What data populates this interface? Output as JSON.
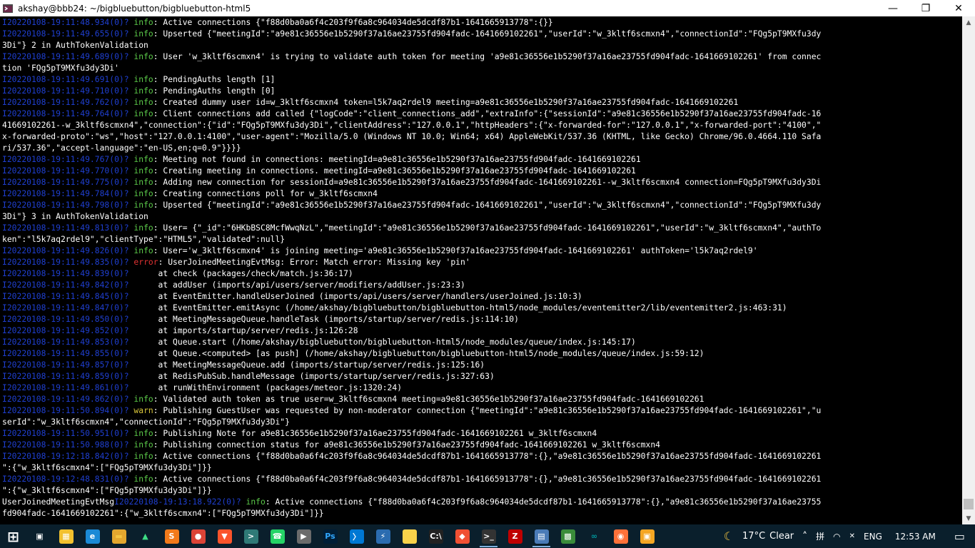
{
  "window": {
    "title": "akshay@bbb24: ~/bigbluebutton/bigbluebutton-html5",
    "minimize_label": "—",
    "maximize_label": "❐",
    "close_label": "✕"
  },
  "terminal": {
    "lines": [
      {
        "ts": "I20220108-19:11:48.934(0)?",
        "lvl": "info",
        "msg": ": Active connections {\"f88d0ba0a6f4c203f9f6a8c964034de5dcdf87b1-1641665913778\":{}}"
      },
      {
        "ts": "I20220108-19:11:49.655(0)?",
        "lvl": "info",
        "msg": ": Upserted {\"meetingId\":\"a9e81c36556e1b5290f37a16ae23755fd904fadc-1641669102261\",\"userId\":\"w_3kltf6scmxn4\",\"connectionId\":\"FQg5pT9MXfu3dy"
      },
      {
        "ts": "",
        "lvl": "",
        "msg": "3Di\"} 2 in AuthTokenValidation"
      },
      {
        "ts": "I20220108-19:11:49.689(0)?",
        "lvl": "info",
        "msg": ": User 'w_3kltf6scmxn4' is trying to validate auth token for meeting 'a9e81c36556e1b5290f37a16ae23755fd904fadc-1641669102261' from connec"
      },
      {
        "ts": "",
        "lvl": "",
        "msg": "tion 'FQg5pT9MXfu3dy3Di'"
      },
      {
        "ts": "I20220108-19:11:49.691(0)?",
        "lvl": "info",
        "msg": ": PendingAuths length [1]"
      },
      {
        "ts": "I20220108-19:11:49.710(0)?",
        "lvl": "info",
        "msg": ": PendingAuths length [0]"
      },
      {
        "ts": "I20220108-19:11:49.762(0)?",
        "lvl": "info",
        "msg": ": Created dummy user id=w_3kltf6scmxn4 token=l5k7aq2rdel9 meeting=a9e81c36556e1b5290f37a16ae23755fd904fadc-1641669102261"
      },
      {
        "ts": "I20220108-19:11:49.764(0)?",
        "lvl": "info",
        "msg": ": Client connections add called {\"logCode\":\"client_connections_add\",\"extraInfo\":{\"sessionId\":\"a9e81c36556e1b5290f37a16ae23755fd904fadc-16"
      },
      {
        "ts": "",
        "lvl": "",
        "msg": "41669102261--w_3kltf6scmxn4\",\"connection\":{\"id\":\"FQg5pT9MXfu3dy3Di\",\"clientAddress\":\"127.0.0.1\",\"httpHeaders\":{\"x-forwarded-for\":\"127.0.0.1\",\"x-forwarded-port\":\"4100\",\""
      },
      {
        "ts": "",
        "lvl": "",
        "msg": "x-forwarded-proto\":\"ws\",\"host\":\"127.0.0.1:4100\",\"user-agent\":\"Mozilla/5.0 (Windows NT 10.0; Win64; x64) AppleWebKit/537.36 (KHTML, like Gecko) Chrome/96.0.4664.110 Safa"
      },
      {
        "ts": "",
        "lvl": "",
        "msg": "ri/537.36\",\"accept-language\":\"en-US,en;q=0.9\"}}}}"
      },
      {
        "ts": "I20220108-19:11:49.767(0)?",
        "lvl": "info",
        "msg": ": Meeting not found in connections: meetingId=a9e81c36556e1b5290f37a16ae23755fd904fadc-1641669102261"
      },
      {
        "ts": "I20220108-19:11:49.770(0)?",
        "lvl": "info",
        "msg": ": Creating meeting in connections. meetingId=a9e81c36556e1b5290f37a16ae23755fd904fadc-1641669102261"
      },
      {
        "ts": "I20220108-19:11:49.775(0)?",
        "lvl": "info",
        "msg": ": Adding new connection for sessionId=a9e81c36556e1b5290f37a16ae23755fd904fadc-1641669102261--w_3kltf6scmxn4 connection=FQg5pT9MXfu3dy3Di"
      },
      {
        "ts": "I20220108-19:11:49.784(0)?",
        "lvl": "info",
        "msg": ": Creating connections poll for w_3kltf6scmxn4"
      },
      {
        "ts": "I20220108-19:11:49.798(0)?",
        "lvl": "info",
        "msg": ": Upserted {\"meetingId\":\"a9e81c36556e1b5290f37a16ae23755fd904fadc-1641669102261\",\"userId\":\"w_3kltf6scmxn4\",\"connectionId\":\"FQg5pT9MXfu3dy"
      },
      {
        "ts": "",
        "lvl": "",
        "msg": "3Di\"} 3 in AuthTokenValidation"
      },
      {
        "ts": "I20220108-19:11:49.813(0)?",
        "lvl": "info",
        "msg": ": User= {\"_id\":\"6HKbBSC8McfWwqNzL\",\"meetingId\":\"a9e81c36556e1b5290f37a16ae23755fd904fadc-1641669102261\",\"userId\":\"w_3kltf6scmxn4\",\"authTo"
      },
      {
        "ts": "",
        "lvl": "",
        "msg": "ken\":\"l5k7aq2rdel9\",\"clientType\":\"HTML5\",\"validated\":null}"
      },
      {
        "ts": "I20220108-19:11:49.826(0)?",
        "lvl": "info",
        "msg": ": User='w_3kltf6scmxn4' is joining meeting='a9e81c36556e1b5290f37a16ae23755fd904fadc-1641669102261' authToken='l5k7aq2rdel9'"
      },
      {
        "ts": "I20220108-19:11:49.835(0)?",
        "lvl": "error",
        "msg": ": UserJoinedMeetingEvtMsg: Error: Match error: Missing key 'pin'"
      },
      {
        "ts": "I20220108-19:11:49.839(0)?",
        "lvl": "",
        "msg": "     at check (packages/check/match.js:36:17)"
      },
      {
        "ts": "I20220108-19:11:49.842(0)?",
        "lvl": "",
        "msg": "     at addUser (imports/api/users/server/modifiers/addUser.js:23:3)"
      },
      {
        "ts": "I20220108-19:11:49.845(0)?",
        "lvl": "",
        "msg": "     at EventEmitter.handleUserJoined (imports/api/users/server/handlers/userJoined.js:10:3)"
      },
      {
        "ts": "I20220108-19:11:49.847(0)?",
        "lvl": "",
        "msg": "     at EventEmitter.emitAsync (/home/akshay/bigbluebutton/bigbluebutton-html5/node_modules/eventemitter2/lib/eventemitter2.js:463:31)"
      },
      {
        "ts": "I20220108-19:11:49.850(0)?",
        "lvl": "",
        "msg": "     at MeetingMessageQueue.handleTask (imports/startup/server/redis.js:114:10)"
      },
      {
        "ts": "I20220108-19:11:49.852(0)?",
        "lvl": "",
        "msg": "     at imports/startup/server/redis.js:126:28"
      },
      {
        "ts": "I20220108-19:11:49.853(0)?",
        "lvl": "",
        "msg": "     at Queue.start (/home/akshay/bigbluebutton/bigbluebutton-html5/node_modules/queue/index.js:145:17)"
      },
      {
        "ts": "I20220108-19:11:49.855(0)?",
        "lvl": "",
        "msg": "     at Queue.<computed> [as push] (/home/akshay/bigbluebutton/bigbluebutton-html5/node_modules/queue/index.js:59:12)"
      },
      {
        "ts": "I20220108-19:11:49.857(0)?",
        "lvl": "",
        "msg": "     at MeetingMessageQueue.add (imports/startup/server/redis.js:125:16)"
      },
      {
        "ts": "I20220108-19:11:49.859(0)?",
        "lvl": "",
        "msg": "     at RedisPubSub.handleMessage (imports/startup/server/redis.js:327:63)"
      },
      {
        "ts": "I20220108-19:11:49.861(0)?",
        "lvl": "",
        "msg": "     at runWithEnvironment (packages/meteor.js:1320:24)"
      },
      {
        "ts": "I20220108-19:11:49.862(0)?",
        "lvl": "info",
        "msg": ": Validated auth token as true user=w_3kltf6scmxn4 meeting=a9e81c36556e1b5290f37a16ae23755fd904fadc-1641669102261"
      },
      {
        "ts": "I20220108-19:11:50.894(0)?",
        "lvl": "warn",
        "msg": ": Publishing GuestUser was requested by non-moderator connection {\"meetingId\":\"a9e81c36556e1b5290f37a16ae23755fd904fadc-1641669102261\",\"u"
      },
      {
        "ts": "",
        "lvl": "",
        "msg": "serId\":\"w_3kltf6scmxn4\",\"connectionId\":\"FQg5pT9MXfu3dy3Di\"}"
      },
      {
        "ts": "I20220108-19:11:50.951(0)?",
        "lvl": "info",
        "msg": ": Publishing Note for a9e81c36556e1b5290f37a16ae23755fd904fadc-1641669102261 w_3kltf6scmxn4"
      },
      {
        "ts": "I20220108-19:11:50.988(0)?",
        "lvl": "info",
        "msg": ": Publishing connection status for a9e81c36556e1b5290f37a16ae23755fd904fadc-1641669102261 w_3kltf6scmxn4"
      },
      {
        "ts": "I20220108-19:12:18.842(0)?",
        "lvl": "info",
        "msg": ": Active connections {\"f88d0ba0a6f4c203f9f6a8c964034de5dcdf87b1-1641665913778\":{},\"a9e81c36556e1b5290f37a16ae23755fd904fadc-1641669102261"
      },
      {
        "ts": "",
        "lvl": "",
        "msg": "\":{\"w_3kltf6scmxn4\":[\"FQg5pT9MXfu3dy3Di\"]}}"
      },
      {
        "ts": "I20220108-19:12:48.831(0)?",
        "lvl": "info",
        "msg": ": Active connections {\"f88d0ba0a6f4c203f9f6a8c964034de5dcdf87b1-1641665913778\":{},\"a9e81c36556e1b5290f37a16ae23755fd904fadc-1641669102261"
      },
      {
        "ts": "",
        "lvl": "",
        "msg": "\":{\"w_3kltf6scmxn4\":[\"FQg5pT9MXfu3dy3Di\"]}}"
      },
      {
        "ts": "I20220108-19:13:18.922(0)?",
        "lvl": "info",
        "prefix": "UserJoinedMeetingEvtMsg",
        "msg": ": Active connections {\"f88d0ba0a6f4c203f9f6a8c964034de5dcdf87b1-1641665913778\":{},\"a9e81c36556e1b5290f37a16ae23755"
      },
      {
        "ts": "",
        "lvl": "",
        "msg": "fd904fadc-1641669102261\":{\"w_3kltf6scmxn4\":[\"FQg5pT9MXfu3dy3Di\"]}}"
      }
    ]
  },
  "taskbar": {
    "apps": [
      {
        "name": "start-button",
        "glyph": "⊞",
        "color": "#ffffff",
        "bg": "transparent"
      },
      {
        "name": "task-view-button",
        "glyph": "▣",
        "color": "#ffffff",
        "bg": "transparent"
      },
      {
        "name": "store-icon",
        "glyph": "▦",
        "color": "#ffffff",
        "bg": "#f2c12e"
      },
      {
        "name": "edge-icon",
        "glyph": "e",
        "color": "#ffffff",
        "bg": "#1b8ad6"
      },
      {
        "name": "file-explorer-icon",
        "glyph": "▬",
        "color": "#f5c542",
        "bg": "#e3a72f"
      },
      {
        "name": "android-icon",
        "glyph": "▲",
        "color": "#3ddc84",
        "bg": "transparent"
      },
      {
        "name": "sublime-text-icon",
        "glyph": "S",
        "color": "#ffffff",
        "bg": "#f27a1a"
      },
      {
        "name": "chrome-icon",
        "glyph": "●",
        "color": "#ffffff",
        "bg": "#db4437"
      },
      {
        "name": "brave-icon",
        "glyph": "▼",
        "color": "#ffffff",
        "bg": "#fb542b"
      },
      {
        "name": "terminal-icon",
        "glyph": ">",
        "color": "#ffffff",
        "bg": "#2f7a77"
      },
      {
        "name": "whatsapp-icon",
        "glyph": "☎",
        "color": "#ffffff",
        "bg": "#25d366"
      },
      {
        "name": "postman-icon",
        "glyph": "▶",
        "color": "#ffffff",
        "bg": "#6b6b6b"
      },
      {
        "name": "photoshop-icon",
        "glyph": "Ps",
        "color": "#31a8ff",
        "bg": "#001e36"
      },
      {
        "name": "vscode-icon",
        "glyph": "〉",
        "color": "#ffffff",
        "bg": "#0078d4"
      },
      {
        "name": "flash-icon",
        "glyph": "⚡",
        "color": "#ffffff",
        "bg": "#2b6cb0"
      },
      {
        "name": "sticky-notes-icon",
        "glyph": "■",
        "color": "#f8d24a",
        "bg": "#f8d24a"
      },
      {
        "name": "cmd-icon",
        "glyph": "C:\\",
        "color": "#ffffff",
        "bg": "#222222"
      },
      {
        "name": "git-icon",
        "glyph": "◆",
        "color": "#ffffff",
        "bg": "#f05033"
      },
      {
        "name": "wsl-terminal-icon",
        "glyph": ">_",
        "color": "#ffffff",
        "bg": "#333333"
      },
      {
        "name": "filezilla-icon",
        "glyph": "Z",
        "color": "#ffffff",
        "bg": "#bf0000"
      },
      {
        "name": "putty-icon",
        "glyph": "▤",
        "color": "#ffffff",
        "bg": "#4a7bb7"
      },
      {
        "name": "network-icon",
        "glyph": "▩",
        "color": "#ffffff",
        "bg": "#3a8c3a"
      },
      {
        "name": "arduino-icon",
        "glyph": "∞",
        "color": "#00979d",
        "bg": "transparent"
      },
      {
        "name": "firefox-icon",
        "glyph": "◉",
        "color": "#ffffff",
        "bg": "#ff7139"
      },
      {
        "name": "vbox-icon",
        "glyph": "▣",
        "color": "#ffffff",
        "bg": "#f5a623"
      }
    ],
    "tray": {
      "weather_icon": "moon-icon",
      "temperature": "17°C",
      "weather": "Clear",
      "chevron": "˄",
      "input_method": "拼",
      "wifi": "◠",
      "volume": "✕",
      "language": "ENG",
      "time": "12:53 AM",
      "notifications": "▭"
    }
  },
  "colors": {
    "timestamp": "#1f3fd0",
    "info": "#5ccb4a",
    "error": "#e23232",
    "warn": "#d6c43a",
    "taskbar_bg": "#0a1f2c"
  }
}
